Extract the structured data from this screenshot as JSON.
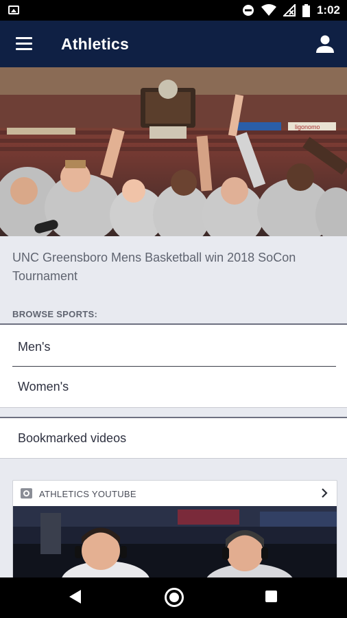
{
  "status_bar": {
    "time": "1:02",
    "icons": [
      "image-icon",
      "dnd-icon",
      "wifi-icon",
      "no-signal-icon",
      "battery-icon"
    ]
  },
  "app_bar": {
    "title": "Athletics",
    "icons": [
      "menu-icon",
      "account-icon"
    ]
  },
  "hero": {
    "caption": "UNC Greensboro Mens Basketball win 2018 SoCon Tournament",
    "arena_sign": "ligonomo"
  },
  "browse": {
    "label": "BROWSE SPORTS:",
    "items": [
      {
        "label": "Men's"
      },
      {
        "label": "Women's"
      }
    ]
  },
  "bookmarks": {
    "label": "Bookmarked videos"
  },
  "youtube": {
    "label": "ATHLETICS YOUTUBE"
  },
  "colors": {
    "app_bar": "#0f2044",
    "page_bg": "#e8eaf0",
    "text_muted": "#5f6470"
  }
}
